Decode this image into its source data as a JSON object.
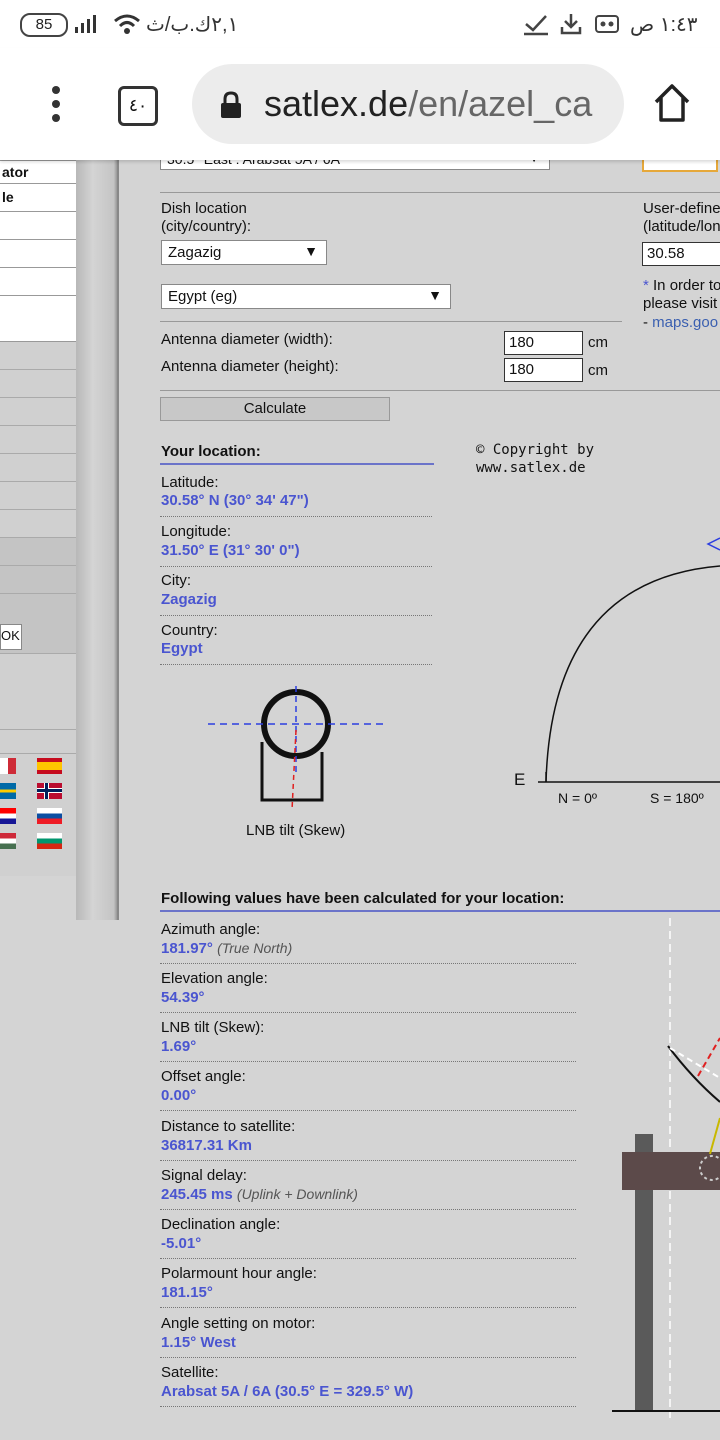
{
  "status": {
    "battery": "85",
    "carrier": "٢,١ك.ب/ث",
    "time": "١:٤٣ ص"
  },
  "browser": {
    "url_domain": "satlex.de",
    "url_path": "/en/azel_ca",
    "tab_count": "٤٠"
  },
  "sidebar": {
    "items": [
      "ator",
      "le"
    ],
    "ok_label": "OK"
  },
  "form": {
    "satellite_select": "30.5° East : Arabsat 5A / 6A",
    "dish_location_label": "Dish location",
    "city_country_label": "(city/country):",
    "city_value": "Zagazig",
    "country_value": "Egypt (eg)",
    "user_defined_label": "User-define",
    "lat_lon_label": "(latitude/lon",
    "user_lat_value": "30.58",
    "note_line1": "In order to",
    "note_line2": "please visit",
    "note_line3": "maps.goo",
    "antenna_width_label": "Antenna diameter (width):",
    "antenna_height_label": "Antenna diameter (height):",
    "antenna_width_value": "180",
    "antenna_height_value": "180",
    "unit": "cm",
    "calculate_label": "Calculate"
  },
  "location": {
    "heading": "Your location:",
    "latitude_label": "Latitude:",
    "latitude_value": "30.58° N (30° 34' 47\")",
    "longitude_label": "Longitude:",
    "longitude_value": "31.50° E (31° 30' 0\")",
    "city_label": "City:",
    "city_value": "Zagazig",
    "country_label": "Country:",
    "country_value": "Egypt",
    "lnb_caption": "LNB tilt (Skew)"
  },
  "diagram": {
    "copyright_line1": "© Copyright by",
    "copyright_line2": "www.satlex.de",
    "east_label": "E",
    "north_label": "N = 0º",
    "south_label": "S = 180º"
  },
  "results": {
    "heading": "Following values have been calculated for your location:",
    "rows": [
      {
        "label": "Azimuth angle:",
        "value": "181.97°",
        "note": "(True North)"
      },
      {
        "label": "Elevation angle:",
        "value": "54.39°",
        "note": ""
      },
      {
        "label": "LNB tilt (Skew):",
        "value": "1.69°",
        "note": ""
      },
      {
        "label": "Offset angle:",
        "value": "0.00°",
        "note": ""
      },
      {
        "label": "Distance to satellite:",
        "value": "36817.31 Km",
        "note": ""
      },
      {
        "label": "Signal delay:",
        "value": "245.45 ms",
        "note": "(Uplink + Downlink)"
      },
      {
        "label": "Declination angle:",
        "value": "-5.01°",
        "note": ""
      },
      {
        "label": "Polarmount hour angle:",
        "value": "181.15°",
        "note": ""
      },
      {
        "label": "Angle setting on motor:",
        "value": "1.15° West",
        "note": ""
      },
      {
        "label": "Satellite:",
        "value": "Arabsat 5A / 6A (30.5° E = 329.5° W)",
        "note": ""
      }
    ]
  }
}
